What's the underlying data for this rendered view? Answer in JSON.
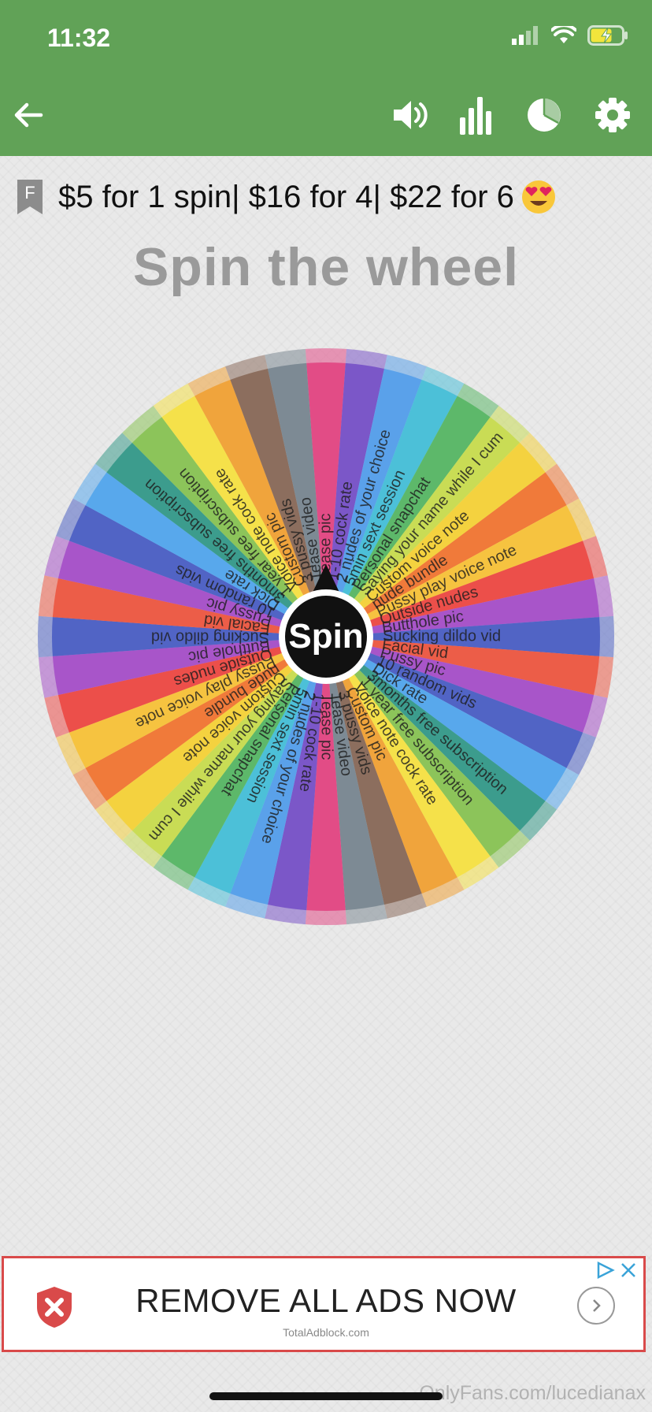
{
  "status_bar": {
    "time": "11:32"
  },
  "toolbar": {
    "back_icon": "arrow-left-icon",
    "actions": [
      {
        "name": "sound-button",
        "icon": "volume-icon"
      },
      {
        "name": "stats-button",
        "icon": "bar-chart-icon"
      },
      {
        "name": "results-button",
        "icon": "pie-chart-icon"
      },
      {
        "name": "settings-button",
        "icon": "gear-icon"
      }
    ],
    "color": "#61a257"
  },
  "notice": {
    "badge": "F",
    "text": "$5 for 1 spin| $16 for 4| $22 for 6"
  },
  "title": "Spin the wheel",
  "wheel": {
    "spin_label": "Spin",
    "segments": [
      {
        "label": "Tease pic",
        "color": "#e24c86"
      },
      {
        "label": "1-10 cock rate",
        "color": "#7b57c8"
      },
      {
        "label": "2 nudes of your choice",
        "color": "#5aa1ea"
      },
      {
        "label": "5min sext session",
        "color": "#4cc0d8"
      },
      {
        "label": "Personal snapchat",
        "color": "#5db86a"
      },
      {
        "label": "Saying your name while I cum",
        "color": "#c9dc55"
      },
      {
        "label": "Custom voice note",
        "color": "#f4d23f"
      },
      {
        "label": "nude bundle",
        "color": "#f07a3a"
      },
      {
        "label": "Pussy play voice note",
        "color": "#f6c340"
      },
      {
        "label": "Outside nudes",
        "color": "#ec4f4a"
      },
      {
        "label": "Butthole pic",
        "color": "#a855c9"
      },
      {
        "label": "Sucking dildo vid",
        "color": "#5164c5"
      },
      {
        "label": "Facial vid",
        "color": "#ec5d48"
      },
      {
        "label": "Pussy pic",
        "color": "#a855c9"
      },
      {
        "label": "10 random vids",
        "color": "#5164c5"
      },
      {
        "label": "Dick rate",
        "color": "#58a8ec"
      },
      {
        "label": "3months free subscription",
        "color": "#3c9c8d"
      },
      {
        "label": "1 year free subscription",
        "color": "#8cc45a"
      },
      {
        "label": "Voice note cock rate",
        "color": "#f5e14a"
      },
      {
        "label": "Custom pic",
        "color": "#f0a43c"
      },
      {
        "label": "3 pussy vids",
        "color": "#8c6e5e"
      },
      {
        "label": "Tease video",
        "color": "#7d8a94"
      },
      {
        "label": "Tease pic",
        "color": "#e24c86"
      },
      {
        "label": "1-10 cock rate",
        "color": "#7b57c8"
      },
      {
        "label": "2 nudes of your choice",
        "color": "#5aa1ea"
      },
      {
        "label": "5min sext session",
        "color": "#4cc0d8"
      },
      {
        "label": "Personal snapchat",
        "color": "#5db86a"
      },
      {
        "label": "Saying your name while I cum",
        "color": "#c9dc55"
      },
      {
        "label": "Custom voice note",
        "color": "#f4d23f"
      },
      {
        "label": "nude bundle",
        "color": "#f07a3a"
      },
      {
        "label": "Pussy play voice note",
        "color": "#f6c340"
      },
      {
        "label": "Outside nudes",
        "color": "#ec4f4a"
      },
      {
        "label": "Butthole pic",
        "color": "#a855c9"
      },
      {
        "label": "Sucking dildo vid",
        "color": "#5164c5"
      },
      {
        "label": "Facial vid",
        "color": "#ec5d48"
      },
      {
        "label": "Pussy pic",
        "color": "#a855c9"
      },
      {
        "label": "10 random vids",
        "color": "#5164c5"
      },
      {
        "label": "Dick rate",
        "color": "#58a8ec"
      },
      {
        "label": "3months free subscription",
        "color": "#3c9c8d"
      },
      {
        "label": "1 year free subscription",
        "color": "#8cc45a"
      },
      {
        "label": "Voice note cock rate",
        "color": "#f5e14a"
      },
      {
        "label": "Custom pic",
        "color": "#f0a43c"
      },
      {
        "label": "3 pussy vids",
        "color": "#8c6e5e"
      },
      {
        "label": "Tease video",
        "color": "#7d8a94"
      }
    ]
  },
  "ad": {
    "headline": "REMOVE ALL ADS NOW",
    "sub": "TotalAdblock.com",
    "accent": "#d94a4a"
  },
  "watermark": "OnlyFans.com/lucedianax"
}
